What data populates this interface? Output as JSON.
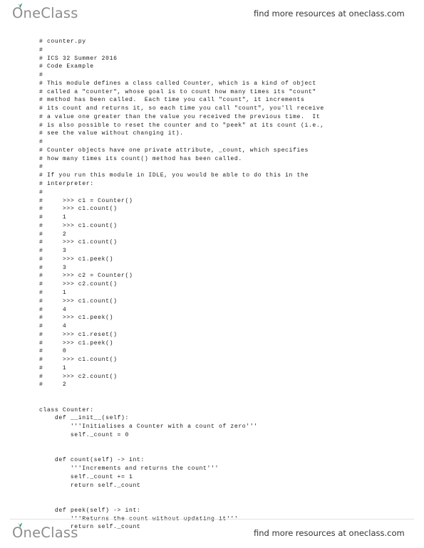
{
  "header": {
    "logo_text": "OneClass",
    "logo_icon": "sprout-icon",
    "logo_color": "#8d8d8d",
    "sprout_color": "#2e8b57",
    "tagline": "find more resources at oneclass.com"
  },
  "footer": {
    "logo_text": "OneClass",
    "logo_icon": "sprout-icon",
    "logo_color": "#8d8d8d",
    "sprout_color": "#2e8b57",
    "tagline": "find more resources at oneclass.com"
  },
  "document": {
    "language": "python",
    "filename": "counter.py",
    "code_lines": [
      "# counter.py",
      "#",
      "# ICS 32 Summer 2016",
      "# Code Example",
      "#",
      "# This module defines a class called Counter, which is a kind of object",
      "# called a \"counter\", whose goal is to count how many times its \"count\"",
      "# method has been called.  Each time you call \"count\", it increments",
      "# its count and returns it, so each time you call \"count\", you'll receive",
      "# a value one greater than the value you received the previous time.  It",
      "# is also possible to reset the counter and to \"peek\" at its count (i.e.,",
      "# see the value without changing it).",
      "#",
      "# Counter objects have one private attribute, _count, which specifies",
      "# how many times its count() method has been called.",
      "#",
      "# If you run this module in IDLE, you would be able to do this in the",
      "# interpreter:",
      "#",
      "#     >>> c1 = Counter()",
      "#     >>> c1.count()",
      "#     1",
      "#     >>> c1.count()",
      "#     2",
      "#     >>> c1.count()",
      "#     3",
      "#     >>> c1.peek()",
      "#     3",
      "#     >>> c2 = Counter()",
      "#     >>> c2.count()",
      "#     1",
      "#     >>> c1.count()",
      "#     4",
      "#     >>> c1.peek()",
      "#     4",
      "#     >>> c1.reset()",
      "#     >>> c1.peek()",
      "#     0",
      "#     >>> c1.count()",
      "#     1",
      "#     >>> c2.count()",
      "#     2",
      "",
      "",
      "class Counter:",
      "    def __init__(self):",
      "        '''Initialises a Counter with a count of zero'''",
      "        self._count = 0",
      "",
      "",
      "    def count(self) -> int:",
      "        '''Increments and returns the count'''",
      "        self._count += 1",
      "        return self._count",
      "",
      "",
      "    def peek(self) -> int:",
      "        '''Returns the count without updating it'''",
      "        return self._count"
    ]
  }
}
